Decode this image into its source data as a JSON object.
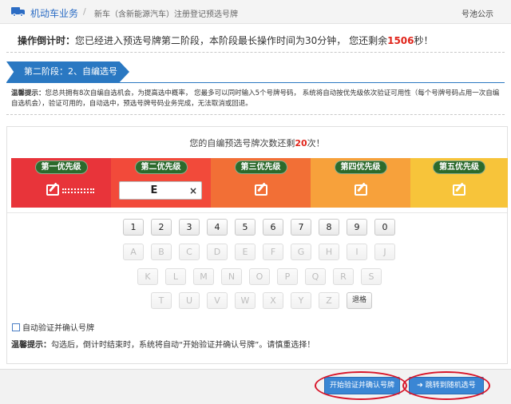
{
  "header": {
    "section": "机动车业务",
    "separator": "/",
    "subtitle": "新车（含新能源汽车）注册登记预选号牌",
    "right_link": "号池公示"
  },
  "countdown": {
    "label": "操作倒计时：",
    "text_before": "您已经进入预选号牌第二阶段，本阶段最长操作时间为30分钟， 您还剩余",
    "seconds": "1506",
    "text_after": "秒！"
  },
  "stage": {
    "title": "第二阶段：2、自编选号"
  },
  "tip": {
    "label": "温馨提示：",
    "text": "您总共拥有8次自编自选机会，为提高选中概率， 您最多可以同时输入5个号牌号码， 系统将自动按优先级依次验证可用性（每个号牌号码占用一次自编自选机会），验证可用的，自动选中，预选号牌号码业务完成，无法取消或回退。"
  },
  "remaining": {
    "before": "您的自编预选号牌次数还剩",
    "count": "20",
    "after": "次！"
  },
  "priorities": [
    {
      "label": "第一优先级"
    },
    {
      "label": "第二优先级",
      "input_value": "E",
      "clear": "×"
    },
    {
      "label": "第三优先级"
    },
    {
      "label": "第四优先级"
    },
    {
      "label": "第五优先级"
    }
  ],
  "colors": {
    "p1": "#e8343a",
    "p2": "#f24a3a",
    "p3": "#f26f36",
    "p4": "#f7a13b",
    "p5": "#f7c43a",
    "accent": "#2a78c2",
    "highlight": "#e0241a"
  },
  "keyboard": {
    "digits": [
      "1",
      "2",
      "3",
      "4",
      "5",
      "6",
      "7",
      "8",
      "9",
      "0"
    ],
    "row2": [
      "A",
      "B",
      "C",
      "D",
      "E",
      "F",
      "G",
      "H",
      "I",
      "J"
    ],
    "row3": [
      "K",
      "L",
      "M",
      "N",
      "O",
      "P",
      "Q",
      "R",
      "S"
    ],
    "row4": [
      "T",
      "U",
      "V",
      "W",
      "X",
      "Y",
      "Z"
    ],
    "backspace": "退格"
  },
  "auto_verify": {
    "label": "自动验证并确认号牌",
    "checked": false
  },
  "warning": {
    "label": "温馨提示：",
    "text": "勾选后，倒计时结束时，系统将自动“开始验证并确认号牌”。请慎重选择！"
  },
  "buttons": {
    "confirm": "开始验证并确认号牌",
    "jump": "➔ 跳转到随机选号"
  }
}
